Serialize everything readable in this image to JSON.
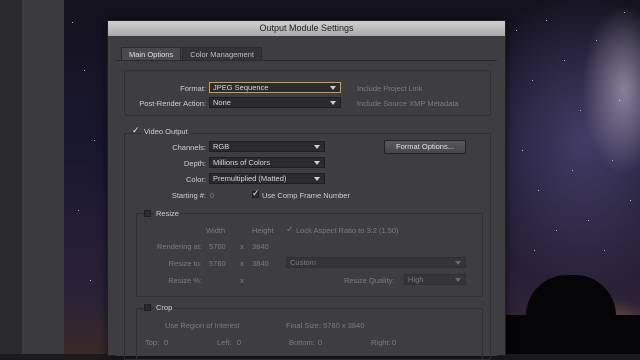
{
  "window": {
    "title": "Output Module Settings"
  },
  "tabs": [
    {
      "label": "Main Options",
      "active": true
    },
    {
      "label": "Color Management",
      "active": false
    }
  ],
  "format_section": {
    "format_label": "Format:",
    "format_value": "JPEG Sequence",
    "post_render_label": "Post-Render Action:",
    "post_render_value": "None",
    "include_project_link": "Include Project Link",
    "include_xmp": "Include Source XMP Metadata"
  },
  "video_output": {
    "label": "Video Output",
    "checked": true,
    "channels_label": "Channels:",
    "channels_value": "RGB",
    "depth_label": "Depth:",
    "depth_value": "Millions of Colors",
    "color_label": "Color:",
    "color_value": "Premultiplied (Matted)",
    "starting_label": "Starting #:",
    "starting_value": "0",
    "use_comp_frame": "Use Comp Frame Number",
    "format_options_button": "Format Options..."
  },
  "resize": {
    "label": "Resize",
    "width_header": "Width",
    "height_header": "Height",
    "lock_aspect": "Lock Aspect Ratio to 3:2 (1.50)",
    "rendering_at_label": "Rendering at:",
    "rendering_w": "5760",
    "rendering_x": "x",
    "rendering_h": "3840",
    "resize_to_label": "Resize to:",
    "resize_w": "5760",
    "resize_x": "x",
    "resize_h": "3840",
    "preset_value": "Custom",
    "resize_pct_label": "Resize %:",
    "resize_pct_x": "x",
    "quality_label": "Resize Quality:",
    "quality_value": "High"
  },
  "crop": {
    "label": "Crop",
    "use_roi": "Use Region of Interest",
    "final_size": "Final Size: 5760 x 3840",
    "top_label": "Top:",
    "top_value": "0",
    "left_label": "Left:",
    "left_value": "0",
    "bottom_label": "Bottom:",
    "bottom_value": "0",
    "right_label": "Right:",
    "right_value": "0"
  }
}
